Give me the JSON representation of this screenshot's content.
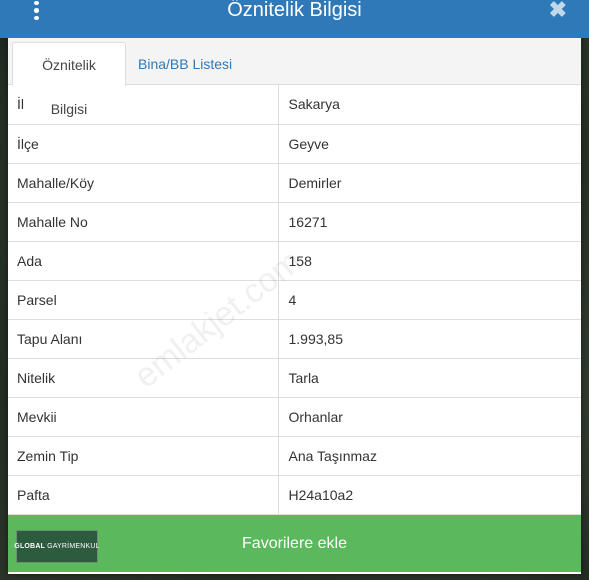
{
  "header": {
    "title": "Öznitelik Bilgisi",
    "close_symbol": "✖"
  },
  "tabs": [
    {
      "label": "Öznitelik Bilgisi",
      "active": true
    },
    {
      "label": "Bina/BB Listesi",
      "active": false
    }
  ],
  "rows": [
    {
      "key": "İl",
      "value": "Sakarya"
    },
    {
      "key": "İlçe",
      "value": "Geyve"
    },
    {
      "key": "Mahalle/Köy",
      "value": "Demirler"
    },
    {
      "key": "Mahalle No",
      "value": "16271"
    },
    {
      "key": "Ada",
      "value": "158"
    },
    {
      "key": "Parsel",
      "value": "4"
    },
    {
      "key": "Tapu Alanı",
      "value": "1.993,85"
    },
    {
      "key": "Nitelik",
      "value": "Tarla"
    },
    {
      "key": "Mevkii",
      "value": "Orhanlar"
    },
    {
      "key": "Zemin Tip",
      "value": "Ana Taşınmaz"
    },
    {
      "key": "Pafta",
      "value": "H24a10a2"
    }
  ],
  "footer": {
    "button_label": "Favorilere ekle"
  },
  "logo": {
    "brand": "GLOBAL",
    "sub": "GAYRİMENKUL"
  },
  "watermark": "emlakjet.com",
  "colors": {
    "header": "#2f79b9",
    "footer": "#5cb85c",
    "tab_link": "#2f79b9"
  },
  "icons": {
    "menu": "vertical-dots-icon",
    "close": "close-icon"
  }
}
